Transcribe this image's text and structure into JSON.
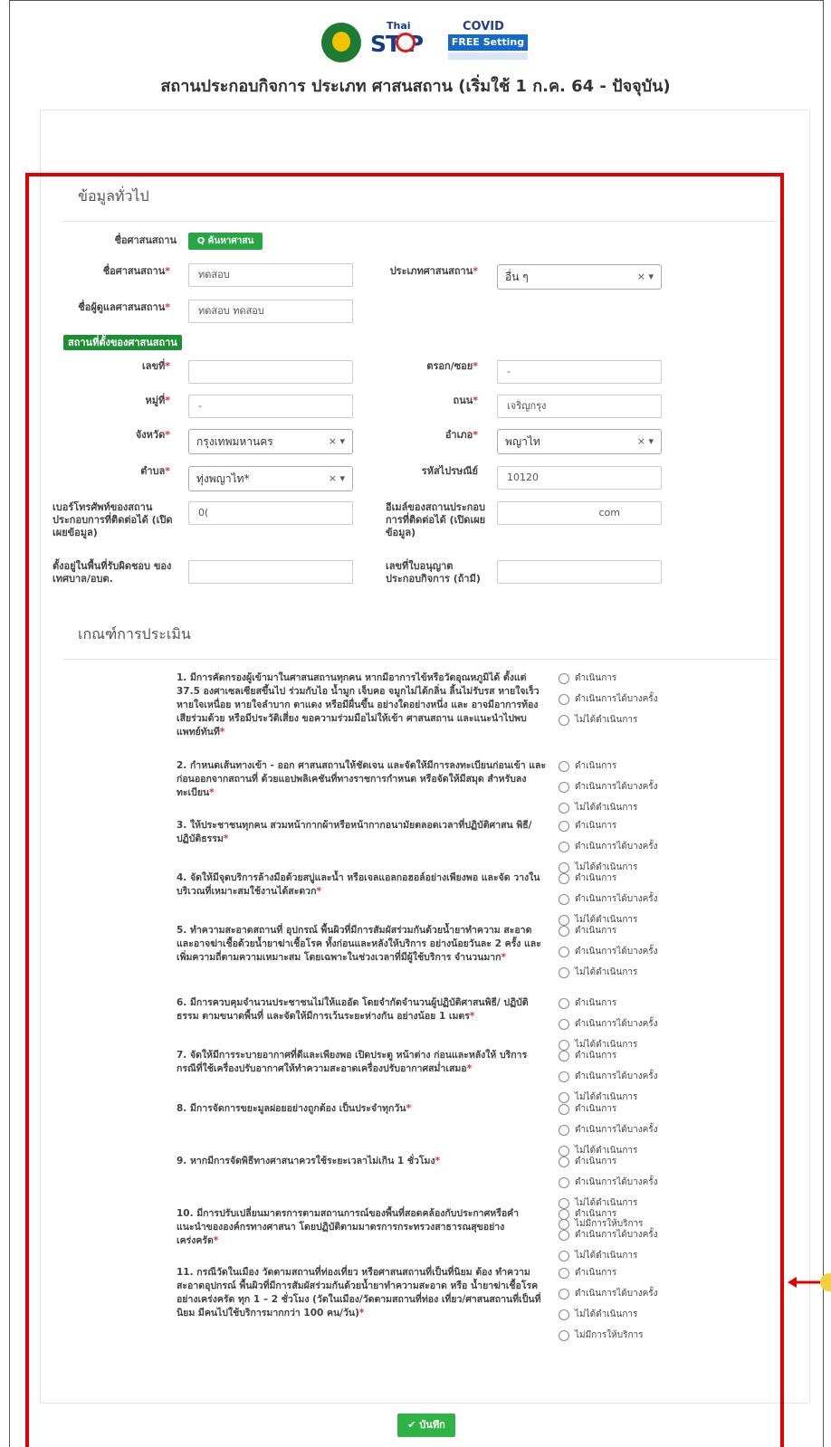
{
  "header": {
    "logo1_name": "thai-health-dept-logo",
    "logo2_top": "Thai",
    "logo2_main": "ST P",
    "logo3_top": "COVID",
    "logo3_main": "FREE Setting",
    "title": "สถานประกอบกิจการ ประเภท ศาสนสถาน (เริ่มใช้ 1 ก.ค. 64 - ปัจจุบัน)"
  },
  "general": {
    "section_title": "ข้อมูลทั่วไป",
    "search_label": "ชื่อศาสนสถาน",
    "search_button": "Q ค้นหาศาสนสถาน",
    "name_label": "ชื่อศาสนสถาน",
    "name_value": "ทดสอบ",
    "type_label": "ประเภทศาสนสถาน",
    "type_value": "อื่น ๆ",
    "manager_label": "ชื่อผู้ดูแลศาสนสถาน",
    "manager_value": "ทดสอบ ทดสอบ",
    "location_badge": "สถานที่ตั้งของศาสนสถาน",
    "no_label": "เลขที่",
    "no_value": "",
    "alley_label": "ตรอก/ซอย",
    "alley_value": "-",
    "moo_label": "หมู่ที่",
    "moo_value": "-",
    "road_label": "ถนน",
    "road_value": "เจริญกรุง",
    "province_label": "จังหวัด",
    "province_value": "กรุงเทพมหานคร",
    "district_label": "อำเภอ",
    "district_value": "พญาไท",
    "subdistrict_label": "ตำบล",
    "subdistrict_value": "ทุ่งพญาไท*",
    "postal_label": "รหัสไปรษณีย์",
    "postal_value": "10120",
    "phone_label": "เบอร์โทรศัพท์ของสถานประกอบการที่ติดต่อได้ (เปิดเผยข้อมูล)",
    "phone_value": "0(",
    "email_label": "อีเมล์ของสถานประกอบการที่ติดต่อได้ (เปิดเผยข้อมูล)",
    "email_value": "com",
    "area_label": "ตั้งอยู่ในพื้นที่รับผิดชอบ ของ เทศบาล/อบต.",
    "area_value": "",
    "license_label": "เลขที่ใบอนุญาตประกอบกิจการ (ถ้ามี)",
    "license_value": "",
    "required_mark": "*"
  },
  "criteria": {
    "section_title": "เกณฑ์การประเมิน",
    "opt_done": "ดำเนินการ",
    "opt_some": "ดำเนินการได้บางครั้ง",
    "opt_not": "ไม่ได้ดำเนินการ",
    "opt_none": "ไม่มีการให้บริการ",
    "questions": [
      "1. มีการคัดกรองผู้เข้ามาในศาสนสถานทุกคน หากมีอาการไข้หรือวัดอุณหภูมิได้ ตั้งแต่ 37.5 องศาเซลเซียสขึ้นไป ร่วมกับไอ น้ำมูก เจ็บคอ จมูกไม่ได้กลิ่น ลิ้นไม่รับรส หายใจเร็ว หายใจเหนื่อย หายใจลำบาก ตาแดง หรือมีผื่นขึ้น อย่างใดอย่างหนึ่ง และ อาจมีอาการท้องเสียร่วมด้วย หรือมีประวัติเสี่ยง ขอความร่วมมือไม่ให้เข้า ศาสนสถาน และแนะนำไปพบแพทย์ทันที",
      "2. กำหนดเส้นทางเข้า - ออก ศาสนสถานให้ชัดเจน และจัดให้มีการลงทะเบียนก่อนเข้า และก่อนออกจากสถานที่ ด้วยแอปพลิเคชันที่ทางราชการกำหนด หรือจัดให้มีสมุด สำหรับลงทะเบียน",
      "3. ให้ประชาชนทุกคน สวมหน้ากากผ้าหรือหน้ากากอนามัยตลอดเวลาที่ปฏิบัติศาสน พิธี/ปฏิบัติธรรม",
      "4. จัดให้มีจุดบริการล้างมือด้วยสบู่และน้ำ หรือเจลแอลกอฮอล์อย่างเพียงพอ และจัด วางในบริเวณที่เหมาะสมใช้งานได้สะดวก",
      "5. ทำความสะอาดสถานที่ อุปกรณ์ พื้นผิวที่มีการสัมผัสร่วมกันด้วยน้ำยาทำความ สะอาด และอาจฆ่าเชื้อด้วยน้ำยาฆ่าเชื้อโรค ทั้งก่อนและหลังให้บริการ อย่างน้อยวันละ 2 ครั้ง และเพิ่มความถี่ตามความเหมาะสม โดยเฉพาะในช่วงเวลาที่มีผู้ใช้บริการ จำนวนมาก",
      "6. มีการควบคุมจำนวนประชาชนไม่ให้แออัด โดยจำกัดจำนวนผู้ปฏิบัติศาสนพิธี/ ปฏิบัติธรรม ตามขนาดพื้นที่ และจัดให้มีการเว้นระยะห่างกัน อย่างน้อย 1 เมตร",
      "7. จัดให้มีการระบายอากาศที่ดีและเพียงพอ เปิดประตู หน้าต่าง ก่อนและหลังให้ บริการ กรณีที่ใช้เครื่องปรับอากาศให้ทำความสะอาดเครื่องปรับอากาศสม่ำเสมอ",
      "8. มีการจัดการขยะมูลฝอยอย่างถูกต้อง เป็นประจำทุกวัน",
      "9. หากมีการจัดพิธีทางศาสนาควรใช้ระยะเวลาไม่เกิน 1 ชั่วโมง",
      "10. มีการปรับเปลี่ยนมาตรการตามสถานการณ์ของพื้นที่สอดคล้องกับประกาศหรือคำ แนะนำขององค์กรทางศาสนา โดยปฏิบัติตามมาตรการกระทรวงสาธารณสุขอย่าง เคร่งครัด",
      "11. กรณีวัดในเมือง วัดตามสถานที่ท่องเที่ยว หรือศาสนสถานที่เป็นที่นิยม ต้อง ทำความสะอาดอุปกรณ์ พื้นผิวที่มีการสัมผัสร่วมกันด้วยน้ำยาทำความสะอาด หรือ น้ำยาฆ่าเชื้อโรค อย่างเคร่งครัด ทุก 1 – 2 ชั่วโมง (วัดในเมือง/วัดตามสถานที่ท่อง เที่ยว/ศาสนสถานที่เป็นที่นิยม มีคนไปใช้บริการมากกว่า 100 คน/วัน)"
    ]
  },
  "footer": {
    "save_button": "✔ บันทึก"
  },
  "colors": {
    "highlight": "#e00000",
    "green": "#27a744",
    "required": "#e52d2d"
  }
}
